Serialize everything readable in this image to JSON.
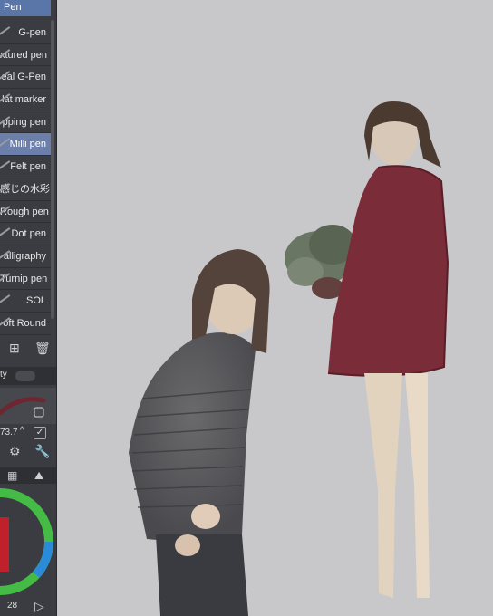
{
  "panel": {
    "title": "Pen",
    "tools": [
      {
        "label": "G-pen"
      },
      {
        "label": "xtured pen"
      },
      {
        "label": "eal G-Pen"
      },
      {
        "label": "lat marker"
      },
      {
        "label": "pping pen"
      },
      {
        "label": "Milli pen",
        "selected": true
      },
      {
        "label": "Felt pen"
      },
      {
        "label": "感じの水彩"
      },
      {
        "label": "Rough pen"
      },
      {
        "label": "Dot pen"
      },
      {
        "label": "alligraphy"
      },
      {
        "label": "Turnip pen"
      },
      {
        "label": "SOL"
      },
      {
        "label": "oft Round"
      }
    ],
    "opacity_label": "ty",
    "brush_size": "73.7",
    "bottom_value": "28",
    "colors": {
      "accent": "#6b7faa",
      "stroke": "#6e2630"
    }
  }
}
